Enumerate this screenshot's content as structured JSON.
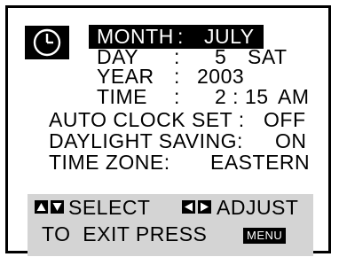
{
  "clock_icon": "clock-icon",
  "month": {
    "label": "MONTH",
    "colon": ":",
    "value": "JULY"
  },
  "day": {
    "label": "DAY",
    "colon": ":",
    "number": "5",
    "weekday": "SAT"
  },
  "year": {
    "label": "YEAR",
    "colon": ":",
    "value": "2003"
  },
  "time": {
    "label": "TIME",
    "colon": ":",
    "value": "2 : 15",
    "ampm": "AM"
  },
  "auto_clock": {
    "label": "AUTO CLOCK SET :",
    "value": "OFF"
  },
  "daylight": {
    "label": "DAYLIGHT SAVING:",
    "value": "ON"
  },
  "timezone": {
    "label": "TIME ZONE:",
    "value": "EASTERN"
  },
  "footer": {
    "select_label": "SELECT",
    "adjust_label": "ADJUST",
    "exit_label": "TO  EXIT PRESS",
    "menu_button": "MENU",
    "icons": [
      "up-down-arrows-icon",
      "left-right-arrows-icon"
    ]
  },
  "colors": {
    "highlight": "#000000",
    "footer_bg": "#d4d4d4",
    "screen_bg": "#ffffff"
  }
}
